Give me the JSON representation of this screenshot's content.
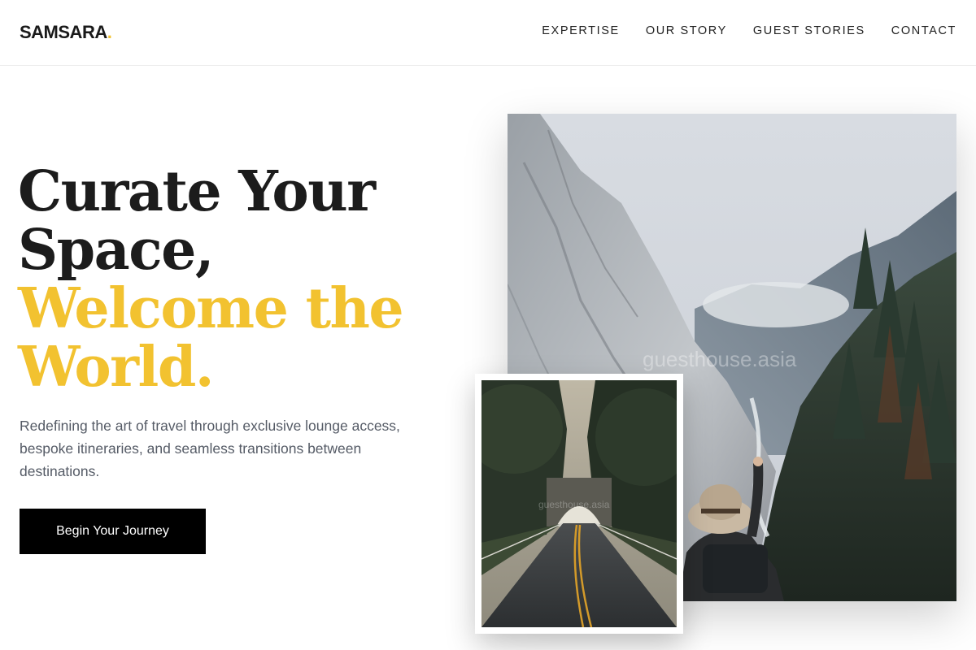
{
  "brand": {
    "name": "SAMSARA",
    "dot": ".",
    "accent_color": "#f2c230"
  },
  "nav": {
    "items": [
      {
        "label": "EXPERTISE"
      },
      {
        "label": "OUR STORY"
      },
      {
        "label": "GUEST STORIES"
      },
      {
        "label": "CONTACT"
      }
    ]
  },
  "hero": {
    "title_lines": [
      "Curate Your",
      "Space,"
    ],
    "accent_lines": [
      "Welcome the",
      "World."
    ],
    "description": "Redefining the art of travel through exclusive lounge access, bespoke itineraries, and seamless transitions between destinations.",
    "cta_label": "Begin Your Journey"
  },
  "images": {
    "main_watermark": "guesthouse.asia",
    "secondary_watermark": "guesthouse.asia"
  }
}
